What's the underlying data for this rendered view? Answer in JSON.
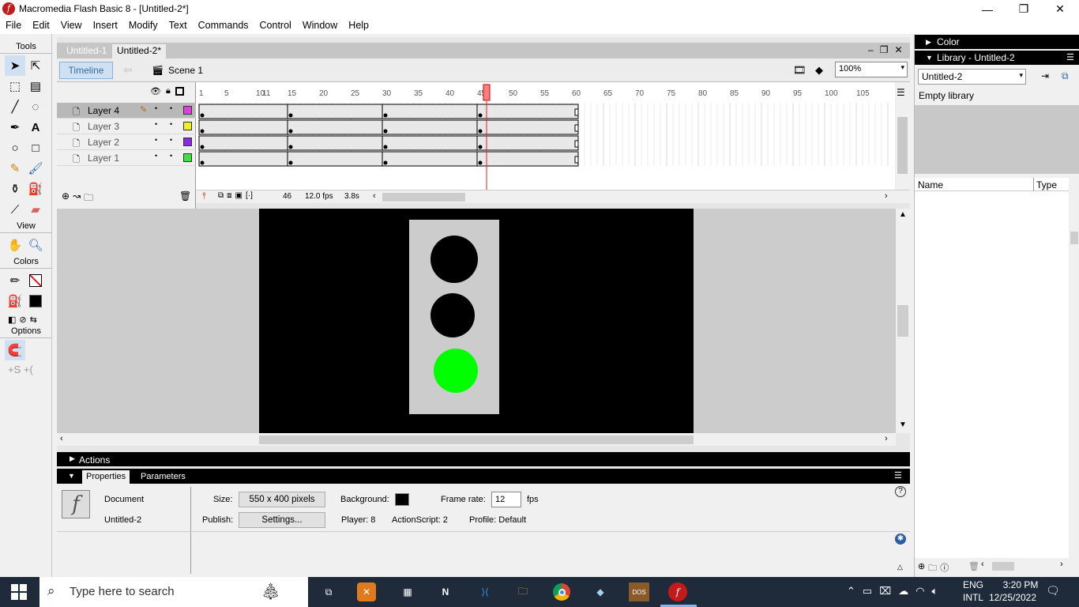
{
  "window": {
    "title": "Macromedia Flash Basic 8 - [Untitled-2*]",
    "minimize": "—",
    "maximize": "❐",
    "close": "✕"
  },
  "menu": [
    "File",
    "Edit",
    "View",
    "Insert",
    "Modify",
    "Text",
    "Commands",
    "Control",
    "Window",
    "Help"
  ],
  "tools": {
    "title": "Tools",
    "view": "View",
    "colors": "Colors",
    "options": "Options"
  },
  "doc_tabs": [
    {
      "label": "Untitled-1"
    },
    {
      "label": "Untitled-2*"
    }
  ],
  "timeline": {
    "button": "Timeline",
    "scene": "Scene 1",
    "zoom": "100%",
    "ruler_ticks": [
      "1",
      "5",
      "10",
      "15",
      "20",
      "25",
      "30",
      "35",
      "40",
      "45",
      "50",
      "55",
      "60",
      "65",
      "70",
      "75",
      "80",
      "85",
      "90",
      "95",
      "100",
      "105",
      "11"
    ],
    "playhead_frame": 46,
    "layers": [
      {
        "name": "Layer 4",
        "color": "#e040e0",
        "selected": true
      },
      {
        "name": "Layer 3",
        "color": "#f0f020",
        "selected": false
      },
      {
        "name": "Layer 2",
        "color": "#8a2be2",
        "selected": false
      },
      {
        "name": "Layer 1",
        "color": "#40e040",
        "selected": false
      }
    ],
    "current_frame": "46",
    "fps": "12.0 fps",
    "time": "3.8s"
  },
  "stage": {
    "lights": [
      {
        "name": "top-light",
        "color": "#000000"
      },
      {
        "name": "middle-light",
        "color": "#000000"
      },
      {
        "name": "bottom-light",
        "color": "#00ff00"
      }
    ],
    "housing_color": "#cccccc"
  },
  "actions_label": "Actions",
  "properties": {
    "tab_properties": "Properties",
    "tab_parameters": "Parameters",
    "doc_label": "Document",
    "doc_name": "Untitled-2",
    "size_label": "Size:",
    "size_value": "550 x 400 pixels",
    "background_label": "Background:",
    "framerate_label": "Frame rate:",
    "framerate_value": "12",
    "fps_unit": "fps",
    "publish_label": "Publish:",
    "settings_button": "Settings...",
    "player": "Player: 8",
    "actionscript": "ActionScript:  2",
    "profile": "Profile:  Default"
  },
  "right_panel": {
    "color_header": "Color",
    "library_header": "Library - Untitled-2",
    "library_select": "Untitled-2",
    "empty_text": "Empty library",
    "col_name": "Name",
    "col_type": "Type"
  },
  "taskbar": {
    "search_placeholder": "Type here to search",
    "lang_top": "ENG",
    "lang_bottom": "INTL",
    "time": "3:20 PM",
    "date": "12/25/2022"
  }
}
